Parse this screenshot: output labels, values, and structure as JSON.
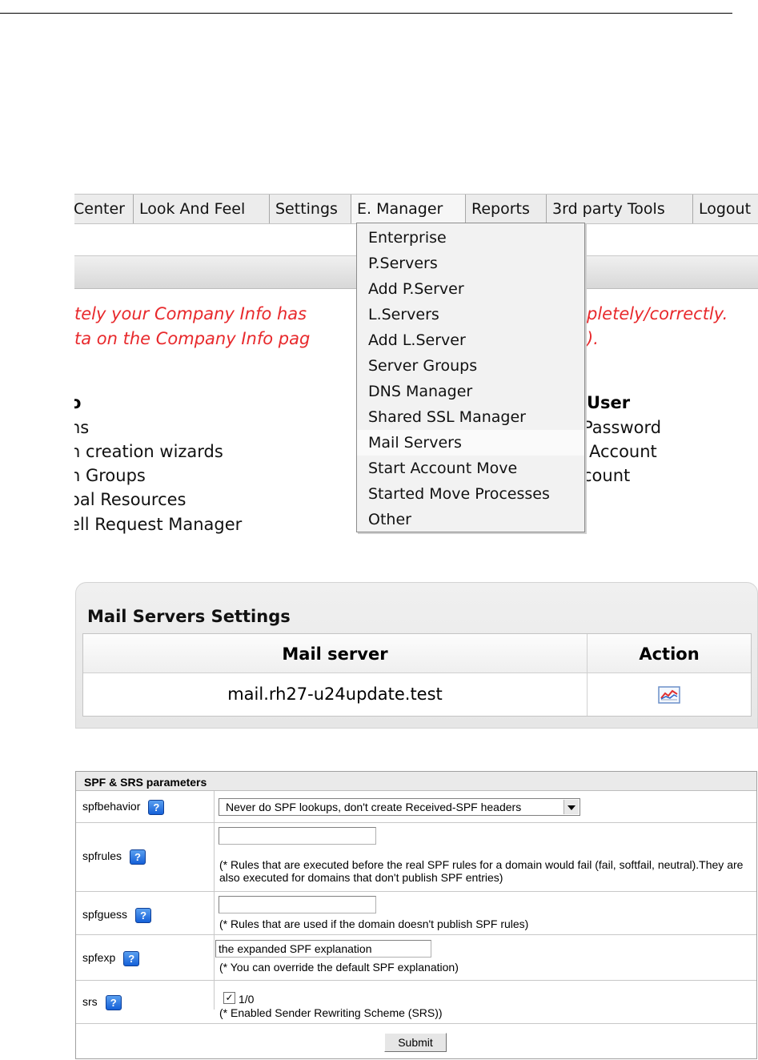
{
  "menubar": {
    "items": [
      "Center",
      "Look And Feel",
      "Settings",
      "E. Manager",
      "Reports",
      "3rd party Tools",
      "Logout"
    ]
  },
  "dropdown": {
    "items": [
      "Enterprise",
      "P.Servers",
      "Add P.Server",
      "L.Servers",
      "Add L.Server",
      "Server Groups",
      "DNS Manager",
      "Shared SSL Manager",
      "Mail Servers",
      "Start Account Move",
      "Started Move Processes",
      "Other"
    ]
  },
  "warning": {
    "line1_left": "tely your Company Info has",
    "line1_right": "pletely/correctly.",
    "line2_left": "ta on the Company Info pag",
    "line2_right": ")."
  },
  "left_section": {
    "heading": "o",
    "links": [
      "ns",
      "n creation wizards",
      "n Groups",
      "oal Resources",
      "ell Request Manager"
    ]
  },
  "right_section": {
    "heading": "User",
    "links": [
      "Password",
      "Account",
      "count"
    ]
  },
  "mail_servers": {
    "title": "Mail Servers Settings",
    "col_server": "Mail server",
    "col_action": "Action",
    "rows": [
      {
        "server": "mail.rh27-u24update.test",
        "action_icon": "chart-icon"
      }
    ]
  },
  "spf": {
    "title": "SPF & SRS parameters",
    "help_icon_glyph": "?",
    "spfbehavior": {
      "label": "spfbehavior",
      "selected": "Never do SPF lookups, don't create Received-SPF headers"
    },
    "spfrules": {
      "label": "spfrules",
      "value": "",
      "note": "(* Rules that are executed before the real SPF rules for a domain would fail (fail, softfail, neutral).They are also executed for domains that don't publish SPF entries)"
    },
    "spfguess": {
      "label": "spfguess",
      "value": "",
      "note": "(* Rules that are used if the domain doesn't publish SPF rules)"
    },
    "spfexp": {
      "label": "spfexp",
      "value": "the expanded SPF explanation",
      "note": "(* You can override the default SPF explanation)"
    },
    "srs": {
      "label": "srs",
      "checkbox_text": "1/0",
      "checked": true,
      "note": "(* Enabled Sender Rewriting Scheme (SRS))"
    },
    "submit_label": "Submit"
  }
}
